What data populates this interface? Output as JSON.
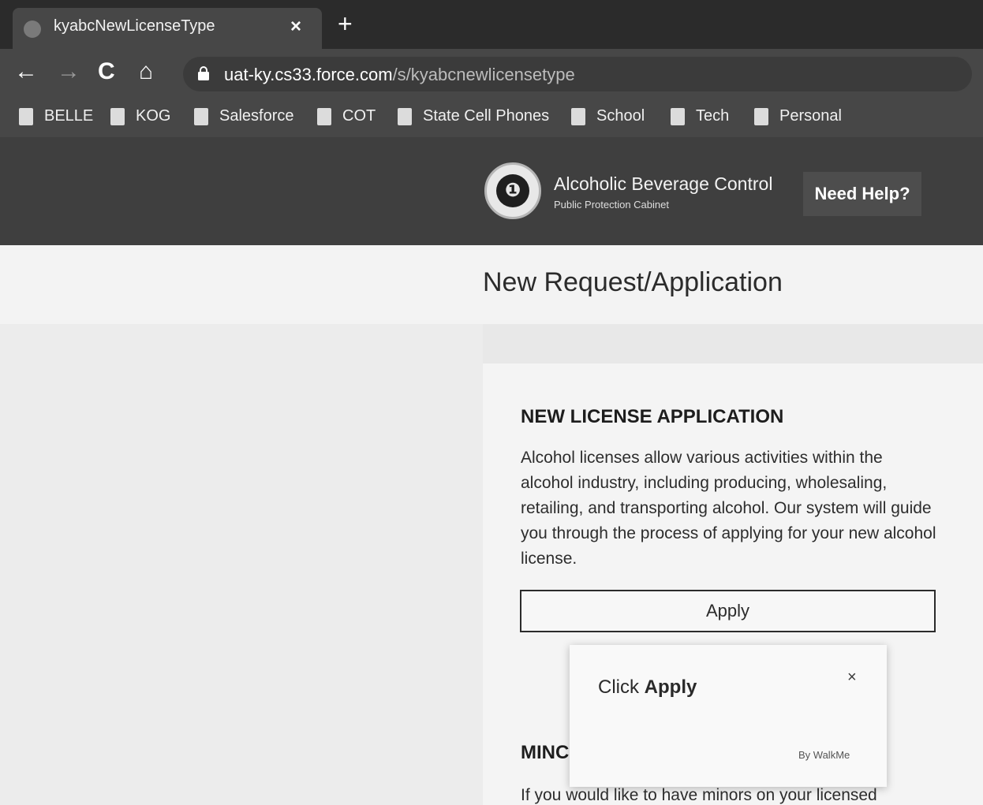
{
  "browser": {
    "tab_title": "kyabcNewLicenseType",
    "tab_close": "×",
    "new_tab": "+",
    "nav": {
      "back": "←",
      "forward": "→",
      "reload": "C",
      "home": "⌂"
    },
    "url_host": "uat-ky.cs33.force.com",
    "url_path": "/s/kyabcnewlicensetype",
    "bookmarks": [
      {
        "label": "BELLE"
      },
      {
        "label": "KOG"
      },
      {
        "label": "Salesforce"
      },
      {
        "label": "COT"
      },
      {
        "label": "State Cell Phones"
      },
      {
        "label": "School"
      },
      {
        "label": "Tech"
      },
      {
        "label": "Personal"
      }
    ]
  },
  "header": {
    "agency_name": "Alcoholic Beverage Control",
    "agency_subtitle": "Public Protection Cabinet",
    "help_label": "Need Help?"
  },
  "page": {
    "title": "New Request/Application"
  },
  "new_license": {
    "heading": "NEW LICENSE APPLICATION",
    "description": "Alcohol licenses allow various activities within the alcohol industry, including producing, wholesaling, retailing, and transporting alcohol. Our system will guide you through the process of applying for your new alcohol license.",
    "apply_label": "Apply"
  },
  "minors": {
    "heading": "MINC",
    "description": "If you would like to have minors on your licensed"
  },
  "walkme": {
    "prefix": "Click ",
    "emphasis": "Apply",
    "close": "×",
    "brand": "By WalkMe"
  }
}
